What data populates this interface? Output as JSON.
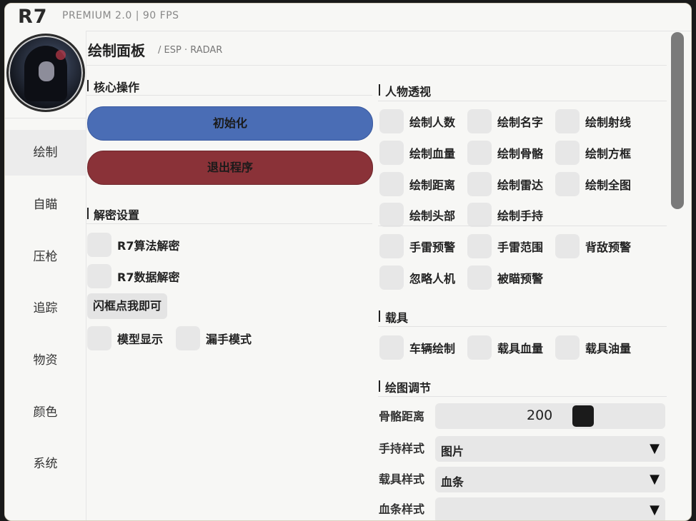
{
  "app": {
    "title": "R7",
    "subtitle": "PREMIUM  2.0  |  90 FPS"
  },
  "sidebar": {
    "items": [
      {
        "label": "绘制",
        "active": true
      },
      {
        "label": "自瞄"
      },
      {
        "label": "压枪"
      },
      {
        "label": "追踪"
      },
      {
        "label": "物资"
      },
      {
        "label": "颜色"
      },
      {
        "label": "系统"
      }
    ]
  },
  "panel": {
    "title": "绘制面板",
    "subtitle": "/ ESP · RADAR"
  },
  "core": {
    "header": "核心操作",
    "init_label": "初始化",
    "exit_label": "退出程序"
  },
  "decrypt": {
    "header": "解密设置",
    "algo_label": "R7算法解密",
    "data_label": "R7数据解密",
    "flash_label": "闪框点我即可",
    "model_label": "模型显示",
    "leak_label": "漏手模式"
  },
  "esp": {
    "header": "人物透视",
    "items": [
      "绘制人数",
      "绘制名字",
      "绘制射线",
      "绘制血量",
      "绘制骨骼",
      "绘制方框",
      "绘制距离",
      "绘制雷达",
      "绘制全图",
      "绘制头部",
      "绘制手持",
      "手雷预警",
      "手雷范围",
      "背敌预警",
      "忽略人机",
      "被瞄预警"
    ]
  },
  "vehicle": {
    "header": "载具",
    "items": [
      "车辆绘制",
      "载具血量",
      "载具油量"
    ]
  },
  "adjust": {
    "header": "绘图调节",
    "skeleton_label": "骨骼距离",
    "skeleton_value": "200",
    "hand_label": "手持样式",
    "hand_value": "图片",
    "vehicle_label": "载具样式",
    "vehicle_value": "血条",
    "health_label": "血条样式",
    "arrow": "▼"
  },
  "colors": {
    "init": "#4a6db5",
    "exit": "#8a3238"
  }
}
